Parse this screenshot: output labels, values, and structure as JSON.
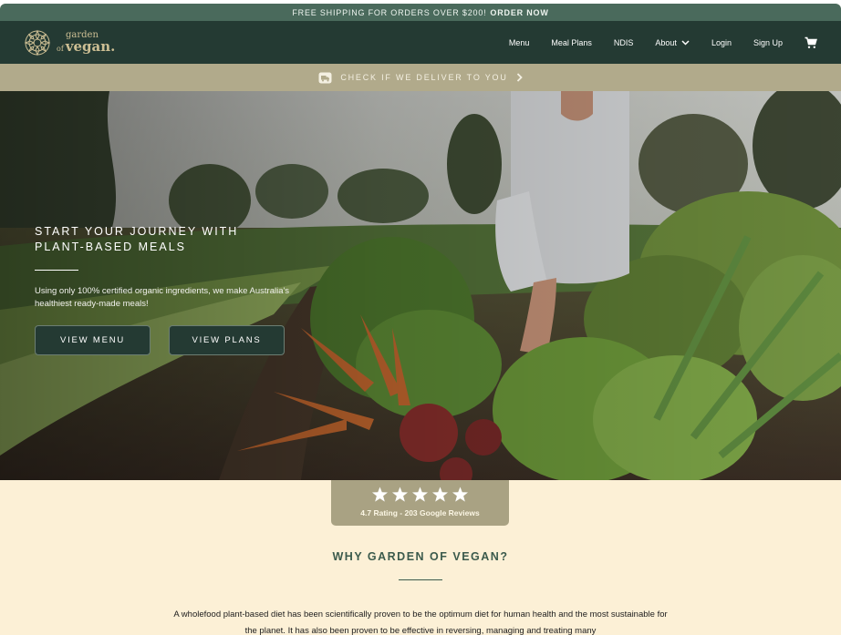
{
  "promo": {
    "text": "FREE SHIPPING FOR ORDERS OVER $200!",
    "link": "ORDER NOW"
  },
  "brand": {
    "line1": "garden",
    "line2_of": "of",
    "line2": "vegan."
  },
  "nav": {
    "items": [
      {
        "label": "Menu"
      },
      {
        "label": "Meal Plans"
      },
      {
        "label": "NDIS"
      },
      {
        "label": "About"
      },
      {
        "label": "Login"
      },
      {
        "label": "Sign Up"
      }
    ],
    "icons": [
      "chevron-down-icon",
      "cart-icon"
    ]
  },
  "delivery": {
    "label": "CHECK IF WE DELIVER TO YOU",
    "icon": "delivery-truck-icon"
  },
  "hero": {
    "title": "START YOUR JOURNEY WITH\nPLANT-BASED MEALS",
    "subtitle": "Using only 100% certified organic ingredients, we make Australia's healthiest ready-made meals!",
    "buttons": [
      "VIEW MENU",
      "VIEW PLANS"
    ]
  },
  "rating": {
    "stars": 5,
    "text": "4.7 Rating - 203 Google Reviews"
  },
  "why": {
    "heading": "WHY GARDEN OF VEGAN?",
    "paragraph": "A wholefood plant-based diet has been scientifically proven to be the optimum diet for human health and the most sustainable for the planet. It has also been proven to be effective in reversing, managing and treating many"
  },
  "colors": {
    "promo_bar": "#4a6a5c",
    "nav_bar": "#243a33",
    "delivery_bar": "#b1aa8b",
    "page_bg": "#fcf0d6",
    "rating_box": "#a9a283",
    "heading": "#3b5a4c"
  }
}
